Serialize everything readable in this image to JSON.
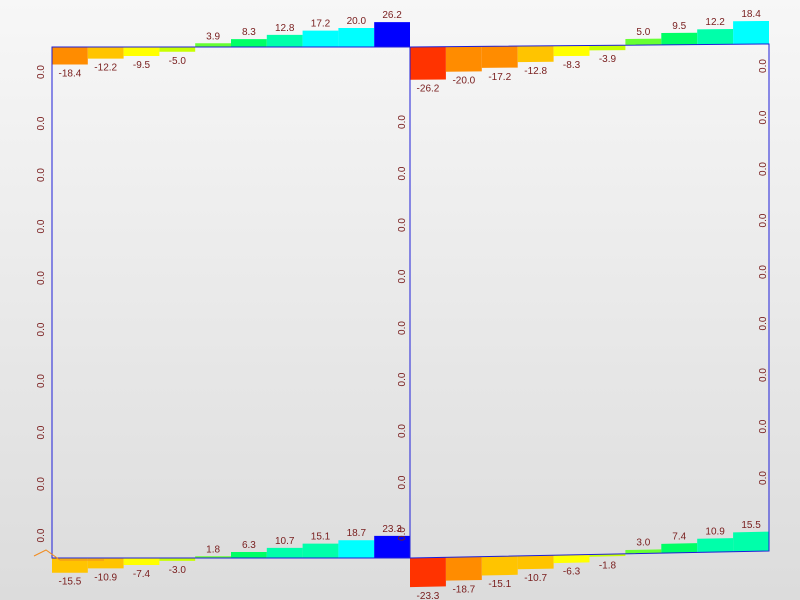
{
  "diagram": {
    "colors": {
      "frame": "#1e1ed8",
      "label": "#7a2020",
      "scale": [
        "#ff3300",
        "#ff8c00",
        "#ffc400",
        "#ffff00",
        "#c8ff00",
        "#66ff33",
        "#00ff66",
        "#00ffaa",
        "#00ffff",
        "#0000ff"
      ]
    },
    "left_frame": {
      "top_beam": {
        "values": [
          "-18.4",
          "-12.2",
          "-9.5",
          "-5.0",
          "3.9",
          "8.3",
          "12.8",
          "17.2",
          "20.0",
          "26.2"
        ]
      },
      "bottom_beam": {
        "values": [
          "-15.5",
          "-10.9",
          "-7.4",
          "-3.0",
          "1.8",
          "6.3",
          "10.7",
          "15.1",
          "18.7",
          "23.3"
        ]
      },
      "column_values": [
        "0.0",
        "0.0",
        "0.0",
        "0.0",
        "0.0",
        "0.0",
        "0.0",
        "0.0",
        "0.0",
        "0.0"
      ]
    },
    "right_frame": {
      "top_beam": {
        "values": [
          "-26.2",
          "-20.0",
          "-17.2",
          "-12.8",
          "-8.3",
          "-3.9",
          "5.0",
          "9.5",
          "12.2",
          "18.4"
        ]
      },
      "bottom_beam": {
        "values": [
          "-23.3",
          "-18.7",
          "-15.1",
          "-10.7",
          "-6.3",
          "-1.8",
          "3.0",
          "7.4",
          "10.9",
          "15.5"
        ]
      },
      "left_column_values": [
        "0.0",
        "0.0",
        "0.0",
        "0.0",
        "0.0",
        "0.0",
        "0.0",
        "0.0",
        "0.0"
      ],
      "right_column_values": [
        "0.0",
        "0.0",
        "0.0",
        "0.0",
        "0.0",
        "0.0",
        "0.0",
        "0.0",
        "0.0"
      ]
    }
  }
}
